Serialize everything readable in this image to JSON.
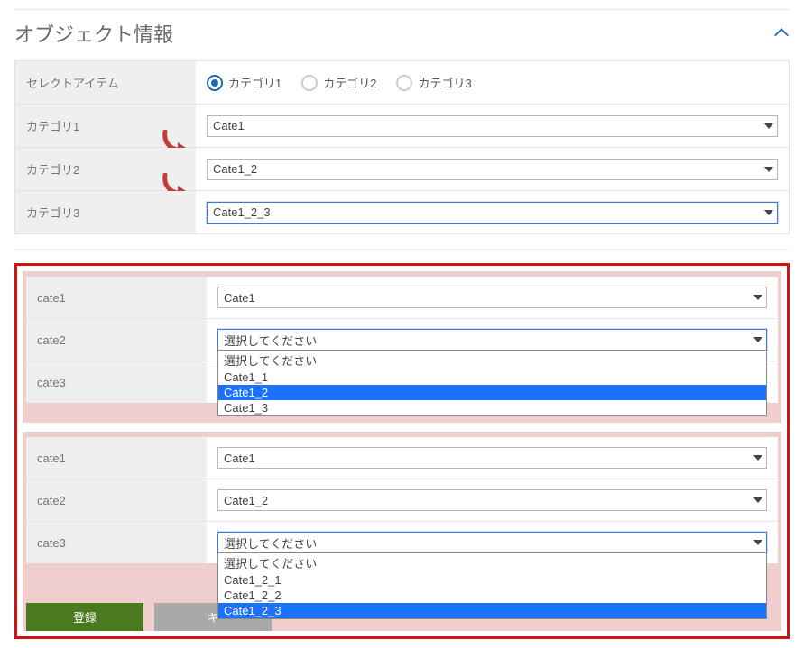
{
  "panel": {
    "title": "オブジェクト情報"
  },
  "top": {
    "select_item_label": "セレクトアイテム",
    "radios": [
      {
        "label": "カテゴリ1",
        "selected": true
      },
      {
        "label": "カテゴリ2",
        "selected": false
      },
      {
        "label": "カテゴリ3",
        "selected": false
      }
    ],
    "cat1_label": "カテゴリ1",
    "cat1_value": "Cate1",
    "cat2_label": "カテゴリ2",
    "cat2_value": "Cate1_2",
    "cat3_label": "カテゴリ3",
    "cat3_value": "Cate1_2_3"
  },
  "group2": {
    "cate1_label": "cate1",
    "cate1_value": "Cate1",
    "cate2_label": "cate2",
    "cate2_value": "選択してください",
    "cate2_options": [
      {
        "text": "選択してください",
        "highlight": false
      },
      {
        "text": "Cate1_1",
        "highlight": false
      },
      {
        "text": "Cate1_2",
        "highlight": true
      },
      {
        "text": "Cate1_3",
        "highlight": false
      }
    ],
    "cate3_label": "cate3",
    "cate3_value": ""
  },
  "group3": {
    "cate1_label": "cate1",
    "cate1_value": "Cate1",
    "cate2_label": "cate2",
    "cate2_value": "Cate1_2",
    "cate3_label": "cate3",
    "cate3_value": "選択してください",
    "cate3_options": [
      {
        "text": "選択してください",
        "highlight": false
      },
      {
        "text": "Cate1_2_1",
        "highlight": false
      },
      {
        "text": "Cate1_2_2",
        "highlight": false
      },
      {
        "text": "Cate1_2_3",
        "highlight": true
      }
    ]
  },
  "actions": {
    "submit": "登録",
    "cancel_prefix": "キ"
  }
}
